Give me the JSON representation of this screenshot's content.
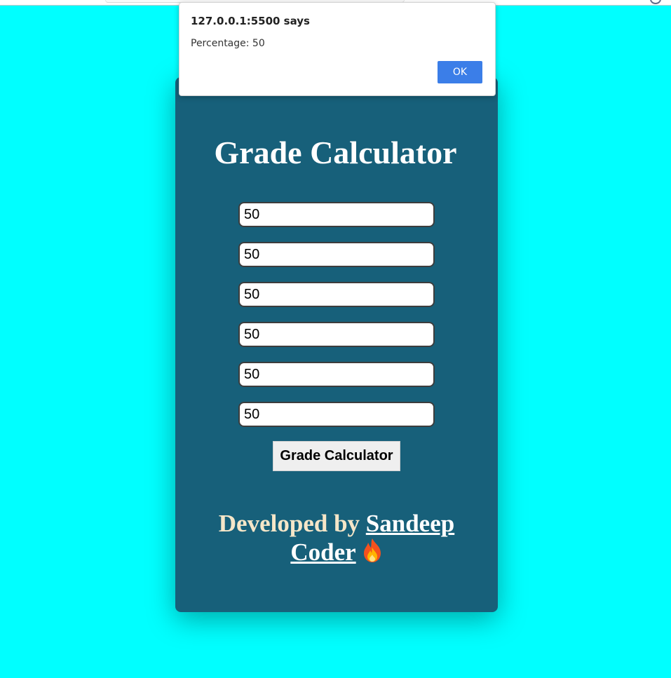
{
  "dialog": {
    "title": "127.0.0.1:5500 says",
    "message": "Percentage: 50",
    "ok_label": "OK"
  },
  "card": {
    "title": "Grade Calculator",
    "inputs": [
      "50",
      "50",
      "50",
      "50",
      "50",
      "50"
    ],
    "button_label": "Grade Calculator",
    "credit_prefix": "Developed by",
    "credit_link": "Sandeep Coder",
    "credit_icon": "fire-icon"
  },
  "colors": {
    "page_background": "#00ffff",
    "card_background": "#17607a",
    "ok_button": "#3b7ee8"
  }
}
